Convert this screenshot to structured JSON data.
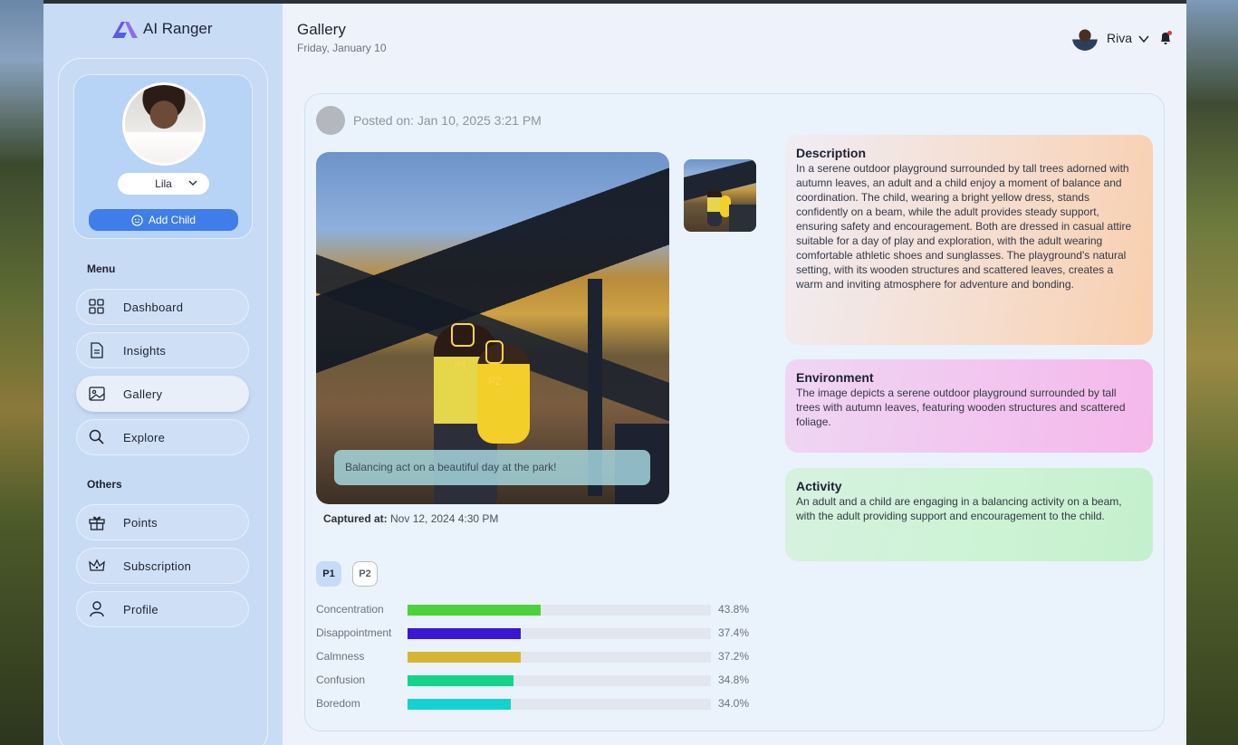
{
  "app": {
    "brand_name": "AI Ranger",
    "accent": "#3f7de8"
  },
  "sidebar": {
    "child_name": "Lila",
    "add_child_label": "Add Child",
    "menu_heading": "Menu",
    "menu_items": [
      {
        "label": "Dashboard",
        "icon": "grid-icon"
      },
      {
        "label": "Insights",
        "icon": "document-icon"
      },
      {
        "label": "Gallery",
        "icon": "image-icon",
        "active": true
      },
      {
        "label": "Explore",
        "icon": "search-icon"
      }
    ],
    "others_heading": "Others",
    "other_items": [
      {
        "label": "Points",
        "icon": "gift-icon"
      },
      {
        "label": "Subscription",
        "icon": "crown-icon"
      },
      {
        "label": "Profile",
        "icon": "user-icon"
      }
    ]
  },
  "header": {
    "title": "Gallery",
    "date": "Friday, January 10",
    "user_name": "Riva",
    "notification_dot_color": "#e53935"
  },
  "post": {
    "posted_on": "Posted on: Jan 10, 2025 3:21 PM",
    "caption": "Balancing act on a beautiful day at the park!",
    "captured_label": "Captured at:",
    "captured_value": "Nov 12, 2024 4:30 PM",
    "face_tags": [
      "P1",
      "P2"
    ],
    "person_tabs": [
      {
        "label": "P1",
        "selected": true
      },
      {
        "label": "P2",
        "selected": false
      }
    ],
    "emotions": [
      {
        "name": "Concentration",
        "value": 43.8,
        "display": "43.8%",
        "color": "#4cd13c"
      },
      {
        "name": "Disappointment",
        "value": 37.4,
        "display": "37.4%",
        "color": "#3a16d6"
      },
      {
        "name": "Calmness",
        "value": 37.2,
        "display": "37.2%",
        "color": "#d4b632"
      },
      {
        "name": "Confusion",
        "value": 34.8,
        "display": "34.8%",
        "color": "#14d48a"
      },
      {
        "name": "Boredom",
        "value": 34.0,
        "display": "34.0%",
        "color": "#14d2d2"
      }
    ]
  },
  "description": {
    "title": "Description",
    "body": "In a serene outdoor playground surrounded by tall trees adorned with autumn leaves, an adult and a child enjoy a moment of balance and coordination. The child, wearing a bright yellow dress, stands confidently on a beam, while the adult provides steady support, ensuring safety and encouragement. Both are dressed in casual attire suitable for a day of play and exploration, with the adult wearing comfortable athletic shoes and sunglasses. The playground's natural setting, with its wooden structures and scattered leaves, creates a warm and inviting atmosphere for adventure and bonding."
  },
  "environment": {
    "title": "Environment",
    "body": "The image depicts a serene outdoor playground surrounded by tall trees with autumn leaves, featuring wooden structures and scattered foliage."
  },
  "activity": {
    "title": "Activity",
    "body": "An adult and a child are engaging in a balancing activity on a beam, with the adult providing support and encouragement to the child."
  }
}
